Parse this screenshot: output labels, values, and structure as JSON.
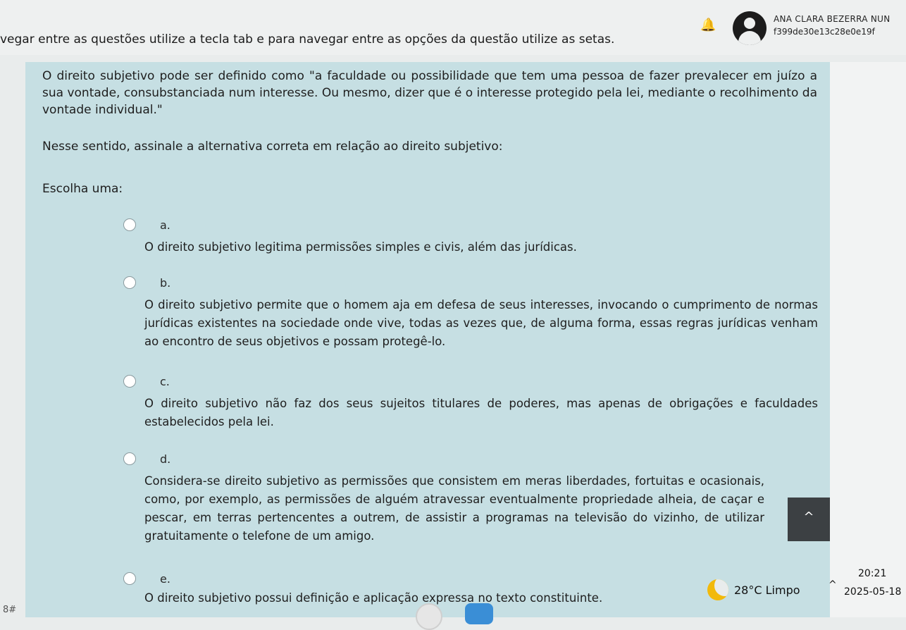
{
  "header": {
    "user_name": "ANA CLARA BEZERRA NUN",
    "user_hash": "f399de30e13c28e0e19f",
    "instruction": "vegar entre as questões utilize a tecla tab e para navegar entre as opções da questão utilize as setas."
  },
  "question": {
    "stem": "O direito subjetivo pode ser definido como \"a faculdade ou possibilidade que tem uma pessoa de fazer prevalecer em juízo a sua vontade, consubstanciada num interesse. Ou mesmo, dizer que é o interesse protegido pela lei, mediante o recolhimento da vontade individual.\"",
    "prompt": "Nesse sentido, assinale a alternativa correta em relação ao direito subjetivo:",
    "choose_label": "Escolha uma:",
    "options": [
      {
        "letter": "a.",
        "text": "O direito subjetivo legitima permissões simples e civis, além das jurídicas."
      },
      {
        "letter": "b.",
        "text": "O direito subjetivo permite que o homem aja em defesa de seus interesses, invocando o cumprimento de normas jurídicas existentes na sociedade onde vive, todas as vezes que, de alguma forma, essas regras jurídicas venham ao encontro de seus objetivos e possam protegê-lo."
      },
      {
        "letter": "c.",
        "text": "O direito subjetivo não faz dos seus sujeitos titulares de poderes, mas apenas de obrigações e faculdades estabelecidos pela lei."
      },
      {
        "letter": "d.",
        "text": "Considera-se direito subjetivo as permissões que consistem em meras liberdades, fortuitas e ocasionais, como, por exemplo, as permissões de alguém atravessar eventualmente propriedade alheia, de caçar e pescar, em terras pertencentes a outrem, de assistir a programas na televisão do vizinho, de utilizar gratuitamente o telefone de um amigo."
      },
      {
        "letter": "e.",
        "text": "O direito subjetivo possui definição e aplicação expressa no texto constituinte."
      }
    ]
  },
  "scroll_top_icon": "chevron-up-icon",
  "scroll_top_glyph": "^",
  "taskbar": {
    "weather": "28°C  Limpo",
    "tray_chevron": "^",
    "time": "20:21",
    "date": "2025-05-18",
    "corner_text": "8#"
  }
}
